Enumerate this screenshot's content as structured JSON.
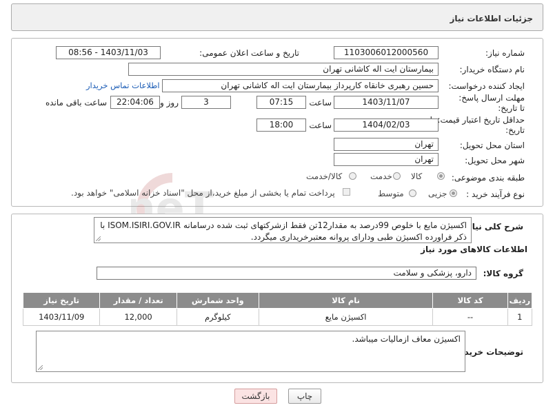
{
  "header": {
    "title": "جزئیات اطلاعات نیاز"
  },
  "form": {
    "need_number_label": "شماره نیاز:",
    "need_number": "1103006012000560",
    "announce_label": "تاریخ و ساعت اعلان عمومی:",
    "announce_value": "1403/11/03 - 08:56",
    "buyer_org_label": "نام دستگاه خریدار:",
    "buyer_org": "بیمارستان ایت اله کاشانی تهران",
    "requester_label": "ایجاد کننده درخواست:",
    "requester": "حسین رهبری خانقاه کارپرداز بیمارستان ایت اله کاشانی تهران",
    "contact_link": "اطلاعات تماس خریدار",
    "deadline_label": "مهلت ارسال پاسخ: تا تاریخ:",
    "deadline_date": "1403/11/07",
    "time_label": "ساعت",
    "deadline_time": "07:15",
    "days_value": "3",
    "days_label": "روز و",
    "remaining_value": "22:04:06",
    "remaining_label": "ساعت باقی مانده",
    "min_validity_label": "حداقل تاریخ اعتبار قیمت: تا تاریخ:",
    "validity_date": "1404/02/03",
    "validity_time": "18:00",
    "province_label": "استان محل تحویل:",
    "province": "تهران",
    "city_label": "شهر محل تحویل:",
    "city": "تهران",
    "category_label": "طبقه بندی موضوعی:",
    "category_options": [
      "کالا",
      "خدمت",
      "کالا/خدمت"
    ],
    "process_label": "نوع فرآیند خرید :",
    "process_options": [
      "جزیی",
      "متوسط"
    ],
    "payment_note": "پرداخت تمام یا بخشی از مبلغ خرید،از محل \"اسناد خزانه اسلامی\" خواهد بود."
  },
  "description": {
    "label": "شرح کلی نیاز:",
    "text": "اکسیژن مایع با خلوص 99درصد به مقدار12تن فقط ازشرکتهای ثبت شده درسامانه ISOM.ISIRI.GOV.IR با ذکر فراورده اکسیژن طبی ودارای پروانه معتبرخریداری میگردد."
  },
  "goods": {
    "section_title": "اطلاعات کالاهای مورد نیاز",
    "group_label": "گروه کالا:",
    "group_value": "دارو، پزشکی و سلامت",
    "columns": [
      "ردیف",
      "کد کالا",
      "نام کالا",
      "واحد شمارش",
      "تعداد / مقدار",
      "تاریخ نیاز"
    ],
    "rows": [
      [
        "1",
        "--",
        "اکسیژن مایع",
        "کیلوگرم",
        "12,000",
        "1403/11/09"
      ]
    ]
  },
  "buyer_notes": {
    "label": "توضیحات خریدار:",
    "text": "اکسیژن معاف ازمالیات میباشد."
  },
  "buttons": {
    "print": "چاپ",
    "back": "بازگشت"
  },
  "watermark": {
    "text": "AriaTender.neT"
  }
}
